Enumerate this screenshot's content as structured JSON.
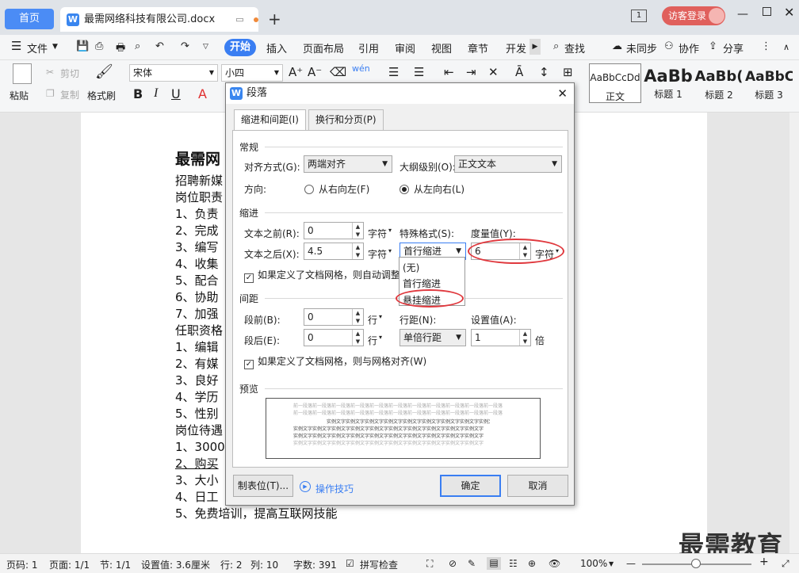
{
  "titlebar": {
    "home_tab": "首页",
    "doc_tab": "最需网络科技有限公司.docx",
    "new_tab": "+",
    "page_count": "1",
    "visitor_login": "访客登录"
  },
  "menubar": {
    "file": "文件",
    "items": [
      "开始",
      "插入",
      "页面布局",
      "引用",
      "审阅",
      "视图",
      "章节",
      "开发"
    ],
    "search": "查找",
    "unsynced": "未同步",
    "collaborate": "协作",
    "share": "分享"
  },
  "ribbon": {
    "paste": "粘贴",
    "cut": "剪切",
    "copy": "复制",
    "format_painter": "格式刷",
    "font_name": "宋体",
    "font_size": "小四",
    "styles": [
      {
        "preview": "AaBbCcDd",
        "name": "正文"
      },
      {
        "preview": "AaBb",
        "name": "标题 1"
      },
      {
        "preview": "AaBb(",
        "name": "标题 2"
      },
      {
        "preview": "AaBbC",
        "name": "标题 3"
      }
    ]
  },
  "document": {
    "title": "最需网",
    "lines": [
      "招聘新媒",
      "岗位职责",
      "1、负责",
      "2、完成",
      "3、编写",
      "4、收集",
      "5、配合",
      "6、协助",
      "7、加强",
      "任职资格",
      "1、编辑",
      "2、有媒",
      "3、良好",
      "4、学历",
      "5、性别",
      "岗位待遇",
      "1、3000",
      "2、购买",
      "3、大小",
      "4、日工",
      "5、免费培训，提高互联网技能"
    ]
  },
  "dialog": {
    "title": "段落",
    "tabs": [
      "缩进和间距(I)",
      "换行和分页(P)"
    ],
    "general_section": "常规",
    "alignment_label": "对齐方式(G):",
    "alignment_value": "两端对齐",
    "outline_label": "大纲级别(O):",
    "outline_value": "正文文本",
    "direction_label": "方向:",
    "rtl_label": "从右向左(F)",
    "ltr_label": "从左向右(L)",
    "indent_section": "缩进",
    "before_text_label": "文本之前(R):",
    "before_text_value": "0",
    "after_text_label": "文本之后(X):",
    "after_text_value": "4.5",
    "unit_char": "字符",
    "special_label": "特殊格式(S):",
    "special_value": "首行缩进",
    "special_options": [
      "(无)",
      "首行缩进",
      "悬挂缩进"
    ],
    "measure_label": "度量值(Y):",
    "measure_value": "6",
    "auto_adjust_label": "如果定义了文档网格，则自动调整",
    "spacing_section": "间距",
    "before_para_label": "段前(B):",
    "before_para_value": "0",
    "after_para_label": "段后(E):",
    "after_para_value": "0",
    "unit_line": "行",
    "line_spacing_label": "行距(N):",
    "line_spacing_value": "单倍行距",
    "setting_label": "设置值(A):",
    "setting_value": "1",
    "unit_times": "倍",
    "grid_align_label": "如果定义了文档网格，则与网格对齐(W)",
    "preview_section": "预览",
    "preview_prev": "前一段落前一段落前一段落前一段落前一段落前一段落前一段落前一段落前一段落前一段落前一段落",
    "preview_sample": "实例文字实例文字实例文字实例文字实例文字实例文字实例文字实例文字实例文字实例文字",
    "tabs_button": "制表位(T)...",
    "tips_link": "操作技巧",
    "ok": "确定",
    "cancel": "取消"
  },
  "statusbar": {
    "page_num": "页码: 1",
    "page": "页面: 1/1",
    "section": "节: 1/1",
    "setting": "设置值: 3.6厘米",
    "row": "行: 2",
    "col": "列: 10",
    "words": "字数: 391",
    "spellcheck": "拼写检查",
    "zoom": "100%"
  },
  "watermark": "最需教育",
  "colors": {
    "accent": "#3a7ef2",
    "highlight_ring": "#e0393e",
    "visitor": "#e0605c"
  }
}
